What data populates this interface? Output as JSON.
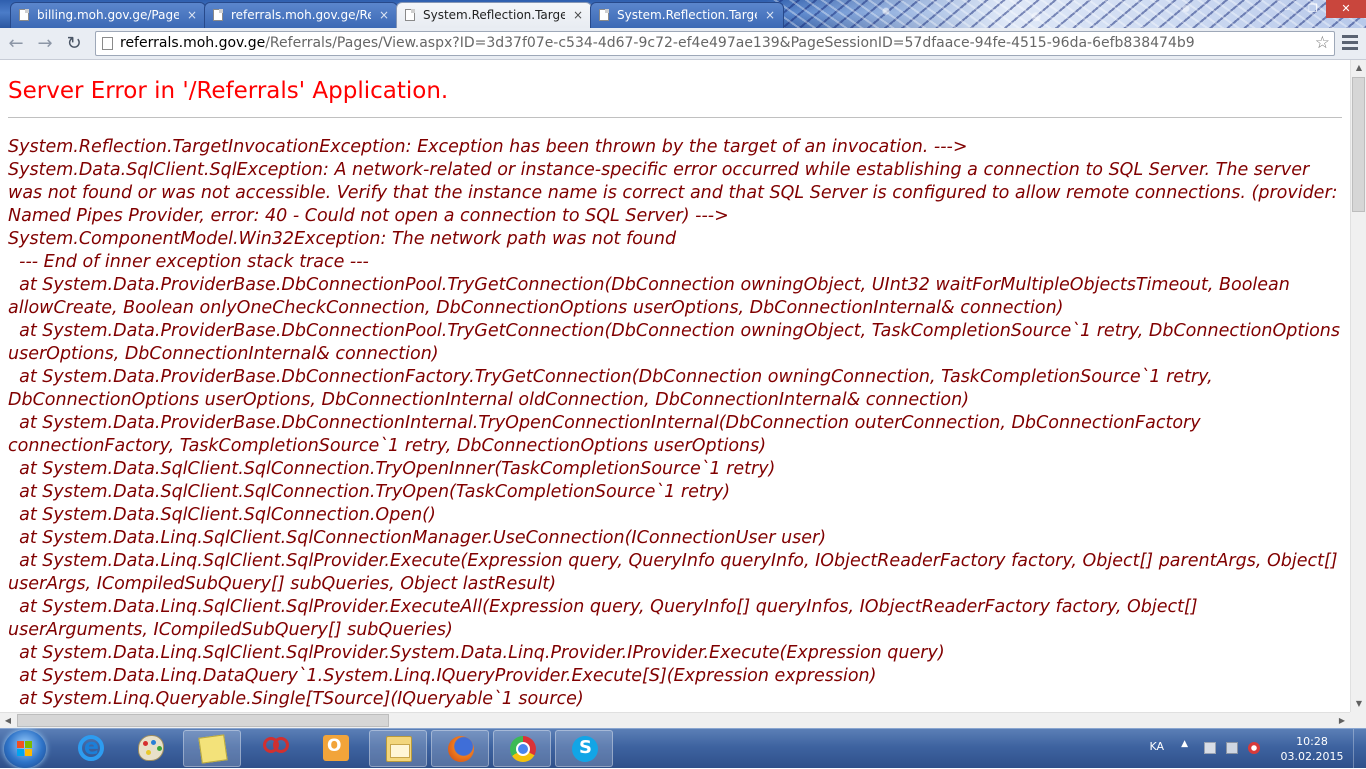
{
  "browser": {
    "tabs": [
      {
        "label": "billing.moh.gov.ge/Pages",
        "active": false
      },
      {
        "label": "referrals.moh.gov.ge/Refe",
        "active": false
      },
      {
        "label": "System.Reflection.TargetI",
        "active": true
      },
      {
        "label": "System.Reflection.TargetI",
        "active": false
      }
    ],
    "tab_close_glyph": "×",
    "url_host": "referrals.moh.gov.ge",
    "url_path": "/Referrals/Pages/View.aspx?ID=3d37f07e-c534-4d67-9c72-ef4e497ae139&PageSessionID=57dfaace-94fe-4515-96da-6efb838474b9",
    "back_glyph": "←",
    "forward_glyph": "→",
    "reload_glyph": "↻",
    "star_glyph": "☆",
    "window_controls": {
      "minimize": "–",
      "maximize": "❐",
      "close": "✕"
    }
  },
  "page": {
    "title": "Server Error in '/Referrals' Application.",
    "lines": [
      "System.Reflection.TargetInvocationException: Exception has been thrown by the target of an invocation. --->",
      "System.Data.SqlClient.SqlException: A network-related or instance-specific error occurred while establishing a connection to SQL Server. The server was not found or was not accessible. Verify that the instance name is correct and that SQL Server is configured to allow remote connections. (provider: Named Pipes Provider, error: 40 - Could not open a connection to SQL Server) --->",
      "System.ComponentModel.Win32Exception: The network path was not found",
      "  --- End of inner exception stack trace ---",
      "  at System.Data.ProviderBase.DbConnectionPool.TryGetConnection(DbConnection owningObject, UInt32 waitForMultipleObjectsTimeout, Boolean allowCreate, Boolean onlyOneCheckConnection, DbConnectionOptions userOptions, DbConnectionInternal& connection)",
      "  at System.Data.ProviderBase.DbConnectionPool.TryGetConnection(DbConnection owningObject, TaskCompletionSource`1 retry, DbConnectionOptions userOptions, DbConnectionInternal& connection)",
      "  at System.Data.ProviderBase.DbConnectionFactory.TryGetConnection(DbConnection owningConnection, TaskCompletionSource`1 retry, DbConnectionOptions userOptions, DbConnectionInternal oldConnection, DbConnectionInternal& connection)",
      "  at System.Data.ProviderBase.DbConnectionInternal.TryOpenConnectionInternal(DbConnection outerConnection, DbConnectionFactory connectionFactory, TaskCompletionSource`1 retry, DbConnectionOptions userOptions)",
      "  at System.Data.SqlClient.SqlConnection.TryOpenInner(TaskCompletionSource`1 retry)",
      "  at System.Data.SqlClient.SqlConnection.TryOpen(TaskCompletionSource`1 retry)",
      "  at System.Data.SqlClient.SqlConnection.Open()",
      "  at System.Data.Linq.SqlClient.SqlConnectionManager.UseConnection(IConnectionUser user)",
      "  at System.Data.Linq.SqlClient.SqlProvider.Execute(Expression query, QueryInfo queryInfo, IObjectReaderFactory factory, Object[] parentArgs, Object[] userArgs, ICompiledSubQuery[] subQueries, Object lastResult)",
      "  at System.Data.Linq.SqlClient.SqlProvider.ExecuteAll(Expression query, QueryInfo[] queryInfos, IObjectReaderFactory factory, Object[] userArguments, ICompiledSubQuery[] subQueries)",
      "  at System.Data.Linq.SqlClient.SqlProvider.System.Data.Linq.Provider.IProvider.Execute(Expression query)",
      "  at System.Data.Linq.DataQuery`1.System.Linq.IQueryProvider.Execute[S](Expression expression)",
      "  at System.Linq.Queryable.Single[TSource](IQueryable`1 source)"
    ],
    "colors": {
      "title": "#ff0000",
      "body": "#800000"
    }
  },
  "scrollbars": {
    "up": "▲",
    "down": "▼",
    "left": "◀",
    "right": "▶"
  },
  "taskbar": {
    "apps": [
      {
        "name": "internet-explorer-icon"
      },
      {
        "name": "paint-icon"
      },
      {
        "name": "sticky-notes-icon"
      },
      {
        "name": "snipping-tool-icon"
      },
      {
        "name": "outlook-icon"
      },
      {
        "name": "file-explorer-icon"
      },
      {
        "name": "firefox-icon"
      },
      {
        "name": "chrome-icon"
      },
      {
        "name": "skype-icon"
      }
    ],
    "language": "KA",
    "tray_arrow": "▲",
    "time": "10:28",
    "date": "03.02.2015"
  }
}
